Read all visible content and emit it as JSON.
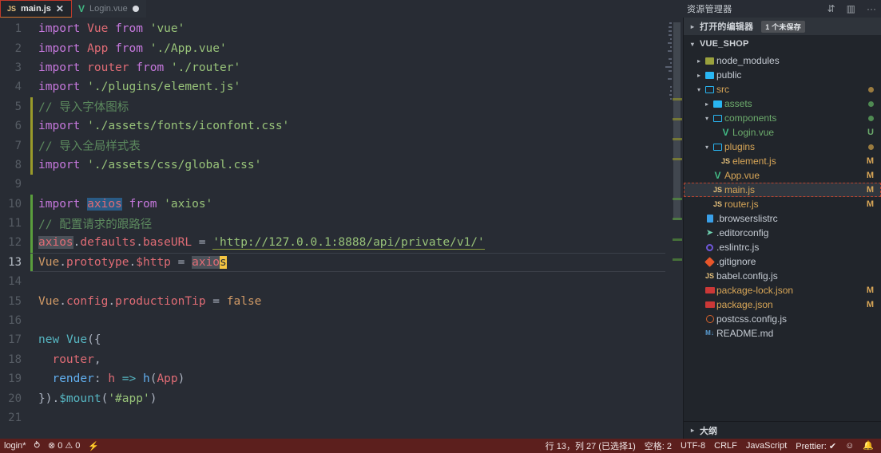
{
  "titlebar": {
    "tabs": [
      {
        "label": "main.js",
        "icon": "js-file-icon",
        "state": "active",
        "close_glyph": "✕",
        "modified": false
      },
      {
        "label": "Login.vue",
        "icon": "vue-file-icon",
        "state": "inactive",
        "close_glyph": "",
        "modified": true
      }
    ],
    "actions": [
      {
        "name": "split-editor-vertical-icon",
        "glyph": "⇵"
      },
      {
        "name": "split-editor-layout-icon",
        "glyph": "▥"
      },
      {
        "name": "more-actions-icon",
        "glyph": "···"
      }
    ],
    "explorer_label": "资源管理器"
  },
  "editor": {
    "language": "JavaScript",
    "lines": [
      {
        "n": "1",
        "gutter": "",
        "active": false,
        "tokens": [
          {
            "t": "import",
            "c": "t-kw"
          },
          {
            "t": " ",
            "c": "t-plain"
          },
          {
            "t": "Vue",
            "c": "t-var"
          },
          {
            "t": " ",
            "c": "t-plain"
          },
          {
            "t": "from",
            "c": "t-kw"
          },
          {
            "t": " ",
            "c": "t-plain"
          },
          {
            "t": "'vue'",
            "c": "t-str"
          }
        ]
      },
      {
        "n": "2",
        "gutter": "",
        "active": false,
        "tokens": [
          {
            "t": "import",
            "c": "t-kw"
          },
          {
            "t": " ",
            "c": "t-plain"
          },
          {
            "t": "App",
            "c": "t-var"
          },
          {
            "t": " ",
            "c": "t-plain"
          },
          {
            "t": "from",
            "c": "t-kw"
          },
          {
            "t": " ",
            "c": "t-plain"
          },
          {
            "t": "'./App.vue'",
            "c": "t-str"
          }
        ]
      },
      {
        "n": "3",
        "gutter": "",
        "active": false,
        "tokens": [
          {
            "t": "import",
            "c": "t-kw"
          },
          {
            "t": " ",
            "c": "t-plain"
          },
          {
            "t": "router",
            "c": "t-var"
          },
          {
            "t": " ",
            "c": "t-plain"
          },
          {
            "t": "from",
            "c": "t-kw"
          },
          {
            "t": " ",
            "c": "t-plain"
          },
          {
            "t": "'./router'",
            "c": "t-str"
          }
        ]
      },
      {
        "n": "4",
        "gutter": "",
        "active": false,
        "tokens": [
          {
            "t": "import",
            "c": "t-kw"
          },
          {
            "t": " ",
            "c": "t-plain"
          },
          {
            "t": "'./plugins/element.js'",
            "c": "t-str"
          }
        ]
      },
      {
        "n": "5",
        "gutter": "mod",
        "active": false,
        "tokens": [
          {
            "t": "// 导入字体图标",
            "c": "t-cmt"
          }
        ]
      },
      {
        "n": "6",
        "gutter": "mod",
        "active": false,
        "tokens": [
          {
            "t": "import",
            "c": "t-kw"
          },
          {
            "t": " ",
            "c": "t-plain"
          },
          {
            "t": "'./assets/fonts/iconfont.css'",
            "c": "t-str"
          }
        ]
      },
      {
        "n": "7",
        "gutter": "mod",
        "active": false,
        "tokens": [
          {
            "t": "// 导入全局样式表",
            "c": "t-cmt"
          }
        ]
      },
      {
        "n": "8",
        "gutter": "mod",
        "active": false,
        "tokens": [
          {
            "t": "import",
            "c": "t-kw"
          },
          {
            "t": " ",
            "c": "t-plain"
          },
          {
            "t": "'./assets/css/global.css'",
            "c": "t-str"
          }
        ]
      },
      {
        "n": "9",
        "gutter": "",
        "active": false,
        "tokens": []
      },
      {
        "n": "10",
        "gutter": "add",
        "active": false,
        "tokens": [
          {
            "t": "import",
            "c": "t-kw"
          },
          {
            "t": " ",
            "c": "t-plain"
          },
          {
            "t": "axios",
            "c": "t-var sel-blue"
          },
          {
            "t": " ",
            "c": "t-plain"
          },
          {
            "t": "from",
            "c": "t-kw"
          },
          {
            "t": " ",
            "c": "t-plain"
          },
          {
            "t": "'axios'",
            "c": "t-str"
          }
        ]
      },
      {
        "n": "11",
        "gutter": "add",
        "active": false,
        "tokens": [
          {
            "t": "// 配置请求的跟路径",
            "c": "t-cmt"
          }
        ]
      },
      {
        "n": "12",
        "gutter": "add",
        "active": false,
        "tokens": [
          {
            "t": "axios",
            "c": "t-var occ"
          },
          {
            "t": ".",
            "c": "t-punc"
          },
          {
            "t": "defaults",
            "c": "t-var"
          },
          {
            "t": ".",
            "c": "t-punc"
          },
          {
            "t": "baseURL",
            "c": "t-var"
          },
          {
            "t": " = ",
            "c": "t-punc"
          },
          {
            "t": "'http://127.0.0.1:8888/api/private/v1/'",
            "c": "t-str url-link"
          }
        ]
      },
      {
        "n": "13",
        "gutter": "add",
        "active": true,
        "tokens": [
          {
            "t": "Vue",
            "c": "t-const"
          },
          {
            "t": ".",
            "c": "t-punc"
          },
          {
            "t": "prototype",
            "c": "t-prop"
          },
          {
            "t": ".",
            "c": "t-punc"
          },
          {
            "t": "$http",
            "c": "t-prop"
          },
          {
            "t": " = ",
            "c": "t-punc"
          },
          {
            "t": "axio",
            "c": "t-var occ"
          },
          {
            "t": "s",
            "c": "cursor-block"
          }
        ]
      },
      {
        "n": "14",
        "gutter": "",
        "active": false,
        "tokens": []
      },
      {
        "n": "15",
        "gutter": "",
        "active": false,
        "tokens": [
          {
            "t": "Vue",
            "c": "t-const"
          },
          {
            "t": ".",
            "c": "t-punc"
          },
          {
            "t": "config",
            "c": "t-prop"
          },
          {
            "t": ".",
            "c": "t-punc"
          },
          {
            "t": "productionTip",
            "c": "t-prop"
          },
          {
            "t": " = ",
            "c": "t-punc"
          },
          {
            "t": "false",
            "c": "t-const"
          }
        ]
      },
      {
        "n": "16",
        "gutter": "",
        "active": false,
        "tokens": []
      },
      {
        "n": "17",
        "gutter": "",
        "active": false,
        "tokens": [
          {
            "t": "new",
            "c": "t-cyan"
          },
          {
            "t": " ",
            "c": "t-plain"
          },
          {
            "t": "Vue",
            "c": "t-cyan"
          },
          {
            "t": "({",
            "c": "t-punc"
          }
        ]
      },
      {
        "n": "18",
        "gutter": "",
        "active": false,
        "tokens": [
          {
            "t": "  ",
            "c": "indent-guide"
          },
          {
            "t": "router",
            "c": "t-var"
          },
          {
            "t": ",",
            "c": "t-punc"
          }
        ]
      },
      {
        "n": "19",
        "gutter": "",
        "active": false,
        "tokens": [
          {
            "t": "  ",
            "c": "indent-guide"
          },
          {
            "t": "render",
            "c": "t-blue"
          },
          {
            "t": ": ",
            "c": "t-punc"
          },
          {
            "t": "h",
            "c": "t-var"
          },
          {
            "t": " => ",
            "c": "t-cyan"
          },
          {
            "t": "h",
            "c": "t-blue"
          },
          {
            "t": "(",
            "c": "t-punc"
          },
          {
            "t": "App",
            "c": "t-var"
          },
          {
            "t": ")",
            "c": "t-punc"
          }
        ]
      },
      {
        "n": "20",
        "gutter": "",
        "active": false,
        "tokens": [
          {
            "t": "})",
            "c": "t-punc"
          },
          {
            "t": ".",
            "c": "t-punc"
          },
          {
            "t": "$mount",
            "c": "t-cyan"
          },
          {
            "t": "(",
            "c": "t-punc"
          },
          {
            "t": "'#app'",
            "c": "t-str"
          },
          {
            "t": ")",
            "c": "t-punc"
          }
        ]
      },
      {
        "n": "21",
        "gutter": "",
        "active": false,
        "tokens": []
      }
    ]
  },
  "sidebar": {
    "opened_editors": {
      "label": "打开的编辑器",
      "badge": "1 个未保存"
    },
    "root": {
      "label": "VUE_SHOP"
    },
    "items": [
      {
        "label": "node_modules",
        "indent": 1,
        "icon": "folder-closed-icon",
        "icon_kind": "folder-closed-yellow",
        "caret": "right",
        "status": "",
        "dot": ""
      },
      {
        "label": "public",
        "indent": 1,
        "icon": "folder-closed-icon",
        "icon_kind": "folder-closed",
        "caret": "right",
        "status": "",
        "dot": ""
      },
      {
        "label": "src",
        "indent": 1,
        "icon": "folder-open-icon",
        "icon_kind": "folder-open",
        "caret": "down",
        "status": "",
        "dot": "#9a7b3f"
      },
      {
        "label": "assets",
        "indent": 2,
        "icon": "folder-closed-icon",
        "icon_kind": "folder-closed",
        "caret": "right",
        "status": "",
        "dot": "#4f8a52"
      },
      {
        "label": "components",
        "indent": 2,
        "icon": "folder-open-icon",
        "icon_kind": "folder-open",
        "caret": "down",
        "status": "",
        "dot": "#4f8a52"
      },
      {
        "label": "Login.vue",
        "indent": 3,
        "icon": "vue-file-icon",
        "icon_kind": "vue",
        "caret": "",
        "status": "U",
        "dot": ""
      },
      {
        "label": "plugins",
        "indent": 2,
        "icon": "folder-open-icon",
        "icon_kind": "folder-open",
        "caret": "down",
        "status": "",
        "dot": "#9a7b3f"
      },
      {
        "label": "element.js",
        "indent": 3,
        "icon": "js-file-icon",
        "icon_kind": "js",
        "caret": "",
        "status": "M",
        "dot": ""
      },
      {
        "label": "App.vue",
        "indent": 2,
        "icon": "vue-file-icon",
        "icon_kind": "vue",
        "caret": "",
        "status": "M",
        "dot": ""
      },
      {
        "label": "main.js",
        "indent": 2,
        "icon": "js-file-icon",
        "icon_kind": "js",
        "caret": "",
        "status": "M",
        "dot": "",
        "selected": true
      },
      {
        "label": "router.js",
        "indent": 2,
        "icon": "js-file-icon",
        "icon_kind": "js",
        "caret": "",
        "status": "M",
        "dot": ""
      },
      {
        "label": ".browserslistrc",
        "indent": 1,
        "icon": "generic-file-icon",
        "icon_kind": "doc",
        "caret": "",
        "status": "",
        "dot": ""
      },
      {
        "label": ".editorconfig",
        "indent": 1,
        "icon": "editorconfig-icon",
        "icon_kind": "editorconfig",
        "caret": "",
        "status": "",
        "dot": ""
      },
      {
        "label": ".eslintrc.js",
        "indent": 1,
        "icon": "eslint-icon",
        "icon_kind": "eslint",
        "caret": "",
        "status": "",
        "dot": ""
      },
      {
        "label": ".gitignore",
        "indent": 1,
        "icon": "git-icon",
        "icon_kind": "git",
        "caret": "",
        "status": "",
        "dot": ""
      },
      {
        "label": "babel.config.js",
        "indent": 1,
        "icon": "js-file-icon",
        "icon_kind": "js",
        "caret": "",
        "status": "",
        "dot": ""
      },
      {
        "label": "package-lock.json",
        "indent": 1,
        "icon": "npm-icon",
        "icon_kind": "npm",
        "caret": "",
        "status": "M",
        "dot": ""
      },
      {
        "label": "package.json",
        "indent": 1,
        "icon": "npm-icon",
        "icon_kind": "npm",
        "caret": "",
        "status": "M",
        "dot": ""
      },
      {
        "label": "postcss.config.js",
        "indent": 1,
        "icon": "postcss-icon",
        "icon_kind": "postcss",
        "caret": "",
        "status": "",
        "dot": ""
      },
      {
        "label": "README.md",
        "indent": 1,
        "icon": "markdown-icon",
        "icon_kind": "md",
        "caret": "",
        "status": "",
        "dot": ""
      }
    ],
    "outline": {
      "label": "大纲"
    }
  },
  "statusbar": {
    "branch": "login*",
    "sync_glyph": "⥁",
    "error_glyph": "⊗",
    "error_count": "0",
    "warn_glyph": "⚠",
    "warn_count": "0",
    "bolt_glyph": "⚡",
    "position": "行 13，列 27 (已选择1)",
    "spaces": "空格: 2",
    "encoding": "UTF-8",
    "eol": "CRLF",
    "language": "JavaScript",
    "prettier": "Prettier: ✔",
    "smiley_glyph": "☺",
    "bell_glyph": "ὑ4"
  },
  "colors": {
    "editor_bg": "#282c34",
    "sidebar_bg": "#21252b",
    "statusbar_bg": "#5c1f1d",
    "accent_red": "#c0392b",
    "cursor": "#f5c542"
  }
}
